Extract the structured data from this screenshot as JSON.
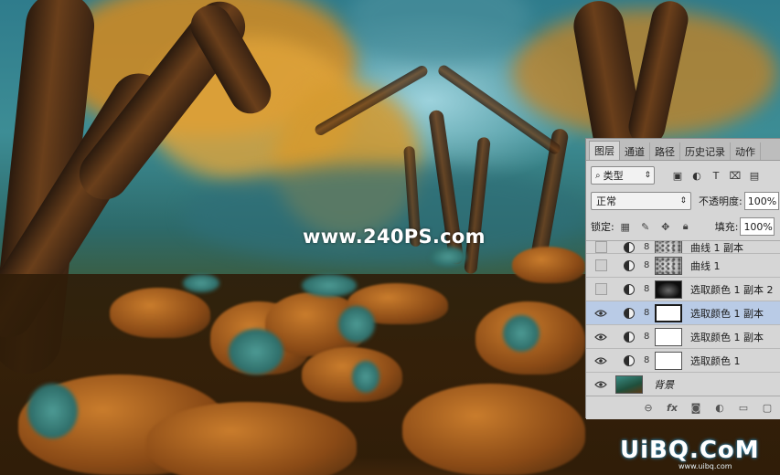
{
  "watermark": "www.240PS.com",
  "logo": {
    "text": "UiBQ.CoM",
    "sub": "www.uibq.com"
  },
  "panel": {
    "tabs": [
      "图层",
      "通道",
      "路径",
      "历史记录",
      "动作"
    ],
    "filter": {
      "kind_label": "类型",
      "icons": [
        "image-filter-icon",
        "adjustment-filter-icon",
        "type-filter-icon",
        "shape-filter-icon",
        "smart-object-filter-icon"
      ]
    },
    "blend_mode": "正常",
    "opacity_label": "不透明度:",
    "opacity_value": "100%",
    "lock_label": "锁定:",
    "fill_label": "填充:",
    "fill_value": "100%",
    "layers": [
      {
        "name": "曲线 1 副本",
        "visible": false,
        "mask": "noise",
        "partial": true
      },
      {
        "name": "曲线 1",
        "visible": false,
        "mask": "noise"
      },
      {
        "name": "选取颜色 1 副本 2",
        "visible": false,
        "mask": "dark"
      },
      {
        "name": "选取颜色 1 副本",
        "visible": true,
        "mask": "white",
        "selected": true
      },
      {
        "name": "选取颜色 1 副本",
        "visible": true,
        "mask": "white"
      },
      {
        "name": "选取颜色 1",
        "visible": true,
        "mask": "white"
      },
      {
        "name": "背景",
        "visible": true,
        "background": true
      }
    ],
    "footer_icons": [
      "link-layers-icon",
      "fx-icon",
      "add-mask-icon",
      "adjustment-layer-icon",
      "new-group-icon",
      "new-layer-icon"
    ]
  },
  "colors": {
    "panel_bg": "#d6d6d6",
    "selected_row": "#b9cbe6"
  }
}
